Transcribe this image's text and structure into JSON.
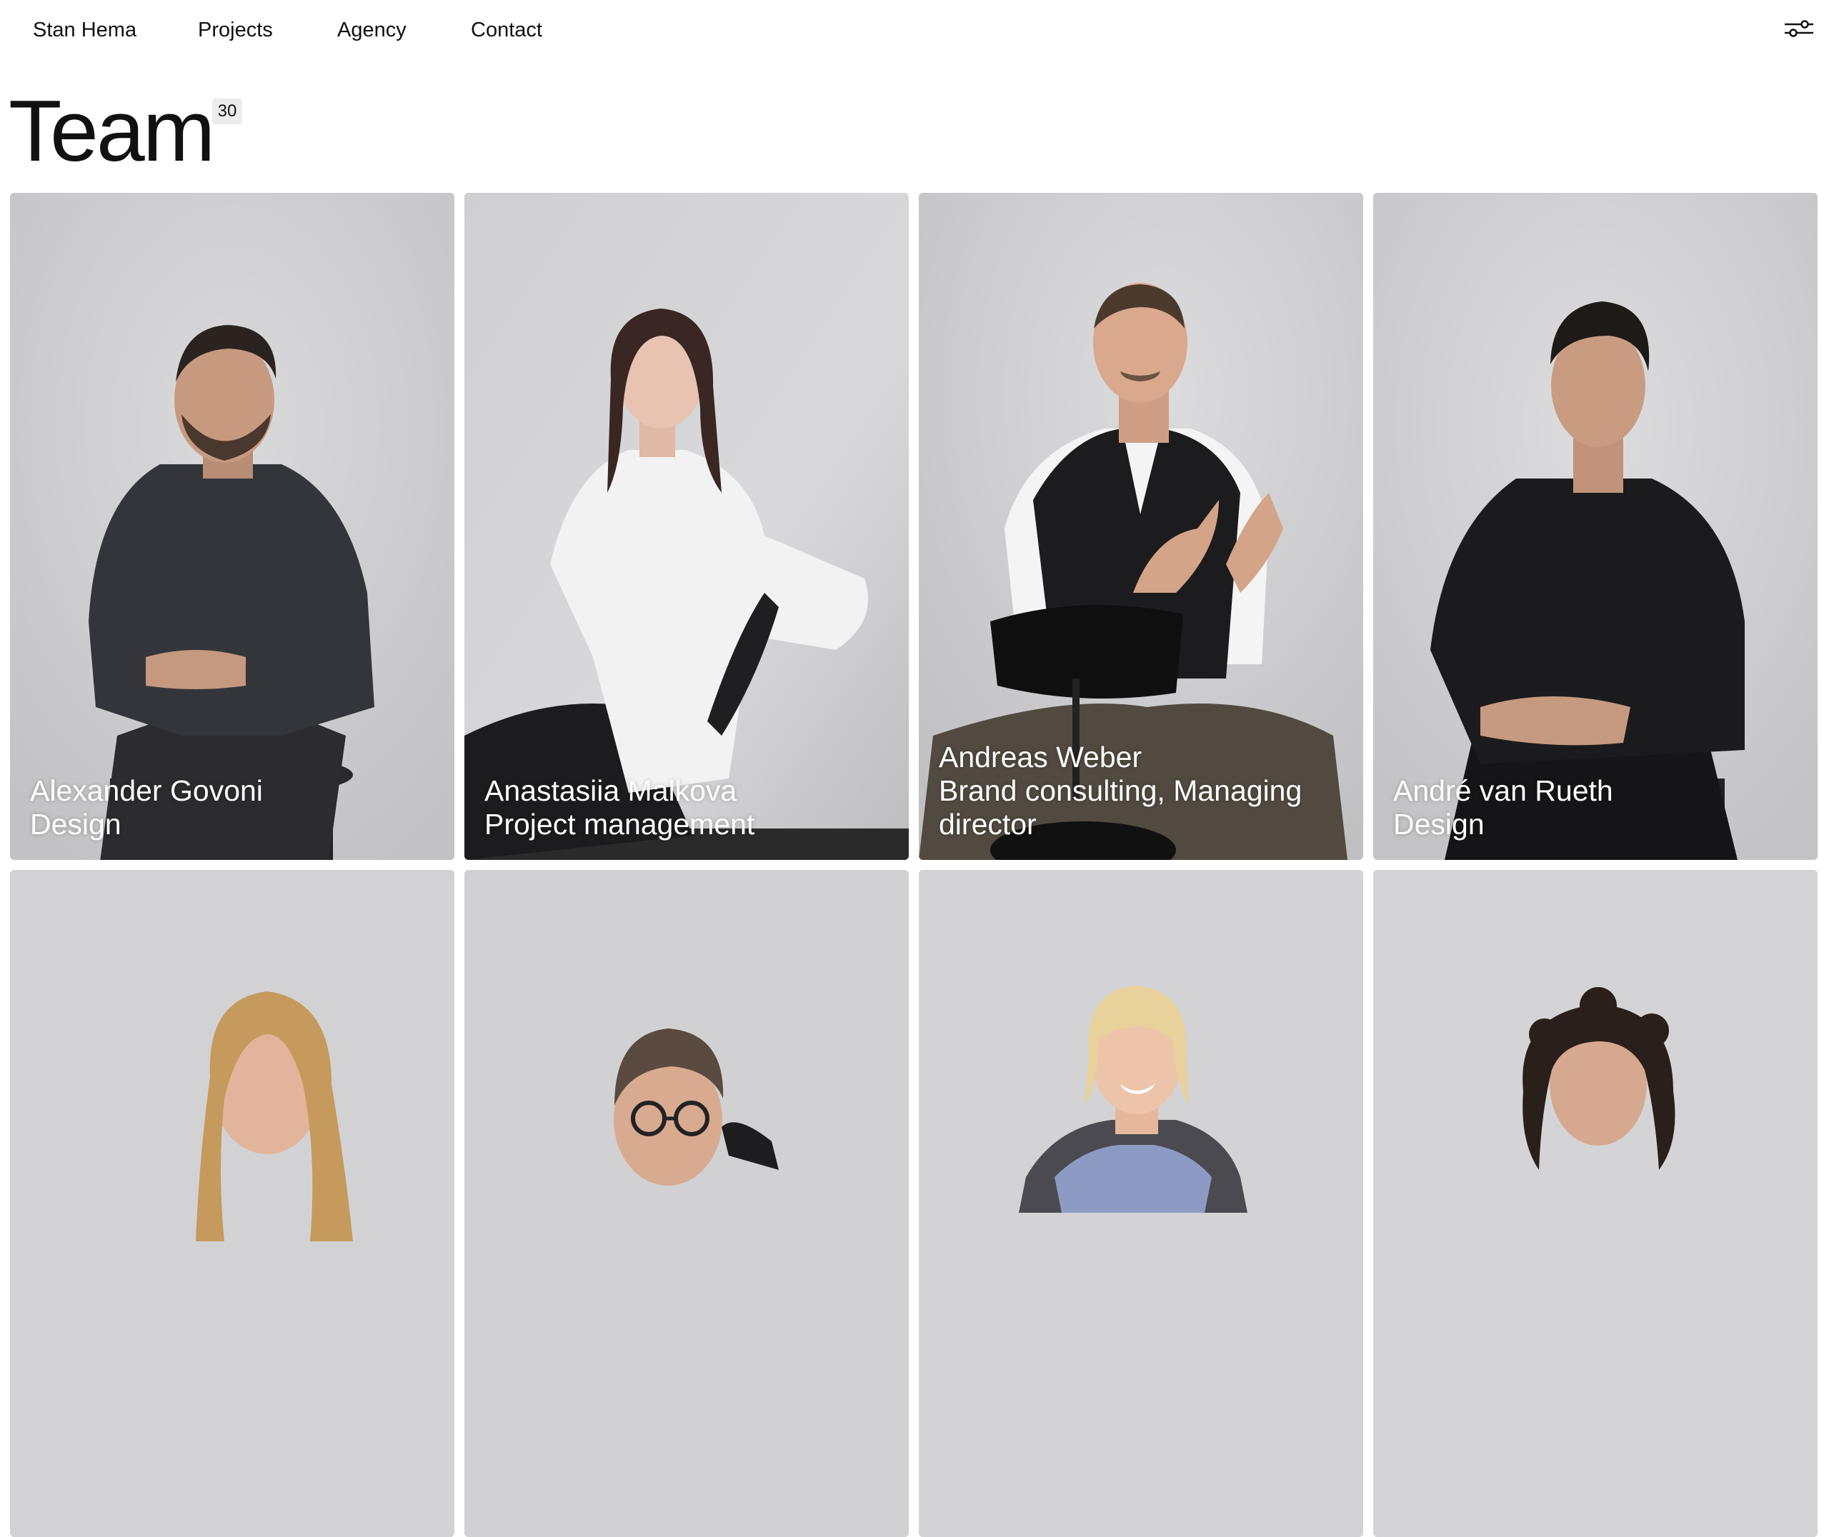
{
  "nav": {
    "brand": "Stan Hema",
    "links": [
      "Projects",
      "Agency",
      "Contact"
    ],
    "settings_icon": "sliders-icon"
  },
  "page": {
    "title": "Team",
    "count": "30"
  },
  "team": [
    {
      "name": "Alexander Govoni",
      "role": "Design"
    },
    {
      "name": "Anastasiia Malkova",
      "role": "Project management"
    },
    {
      "name": "Andreas Weber",
      "role": "Brand consulting, Managing director"
    },
    {
      "name": "André van Rueth",
      "role": "Design"
    },
    {
      "name": "",
      "role": ""
    },
    {
      "name": "",
      "role": ""
    },
    {
      "name": "",
      "role": ""
    },
    {
      "name": "",
      "role": ""
    }
  ],
  "colors": {
    "background": "#ffffff",
    "text": "#111111",
    "badge_bg": "#ececec",
    "photo_backdrop": "#d0d0d2",
    "caption_text": "#ffffff"
  }
}
